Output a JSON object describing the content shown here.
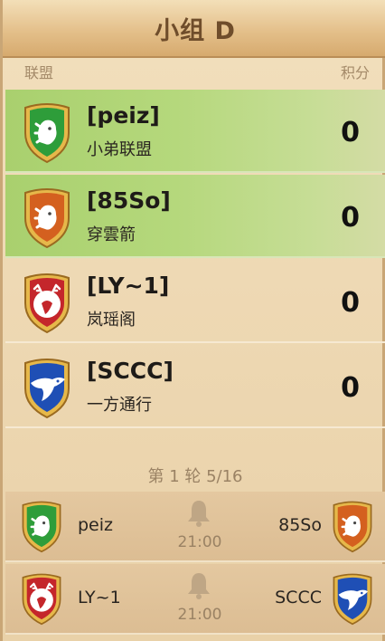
{
  "header": {
    "title": "小组 D"
  },
  "columns": {
    "alliance": "联盟",
    "points": "积分"
  },
  "standings": [
    {
      "tag": "[peiz]",
      "name": "小弟联盟",
      "score": "0",
      "highlight": true,
      "shield": "green-lion"
    },
    {
      "tag": "[85So]",
      "name": "穿雲箭",
      "score": "0",
      "highlight": true,
      "shield": "orange-lion"
    },
    {
      "tag": "[LY~1]",
      "name": "岚瑶阁",
      "score": "0",
      "highlight": false,
      "shield": "red-deer"
    },
    {
      "tag": "[SCCC]",
      "name": "一方通行",
      "score": "0",
      "highlight": false,
      "shield": "blue-eagle"
    }
  ],
  "round": {
    "label": "第 1 轮 5/16"
  },
  "matches": [
    {
      "left": "peiz",
      "right": "85So",
      "time": "21:00",
      "left_shield": "green-lion",
      "right_shield": "orange-lion"
    },
    {
      "left": "LY~1",
      "right": "SCCC",
      "time": "21:00",
      "left_shield": "red-deer",
      "right_shield": "blue-eagle"
    }
  ],
  "colors": {
    "green": "#2e9d3a",
    "orange": "#d4601f",
    "red": "#c4262b",
    "blue": "#1f4fb5",
    "gold": "#e2b23d"
  }
}
